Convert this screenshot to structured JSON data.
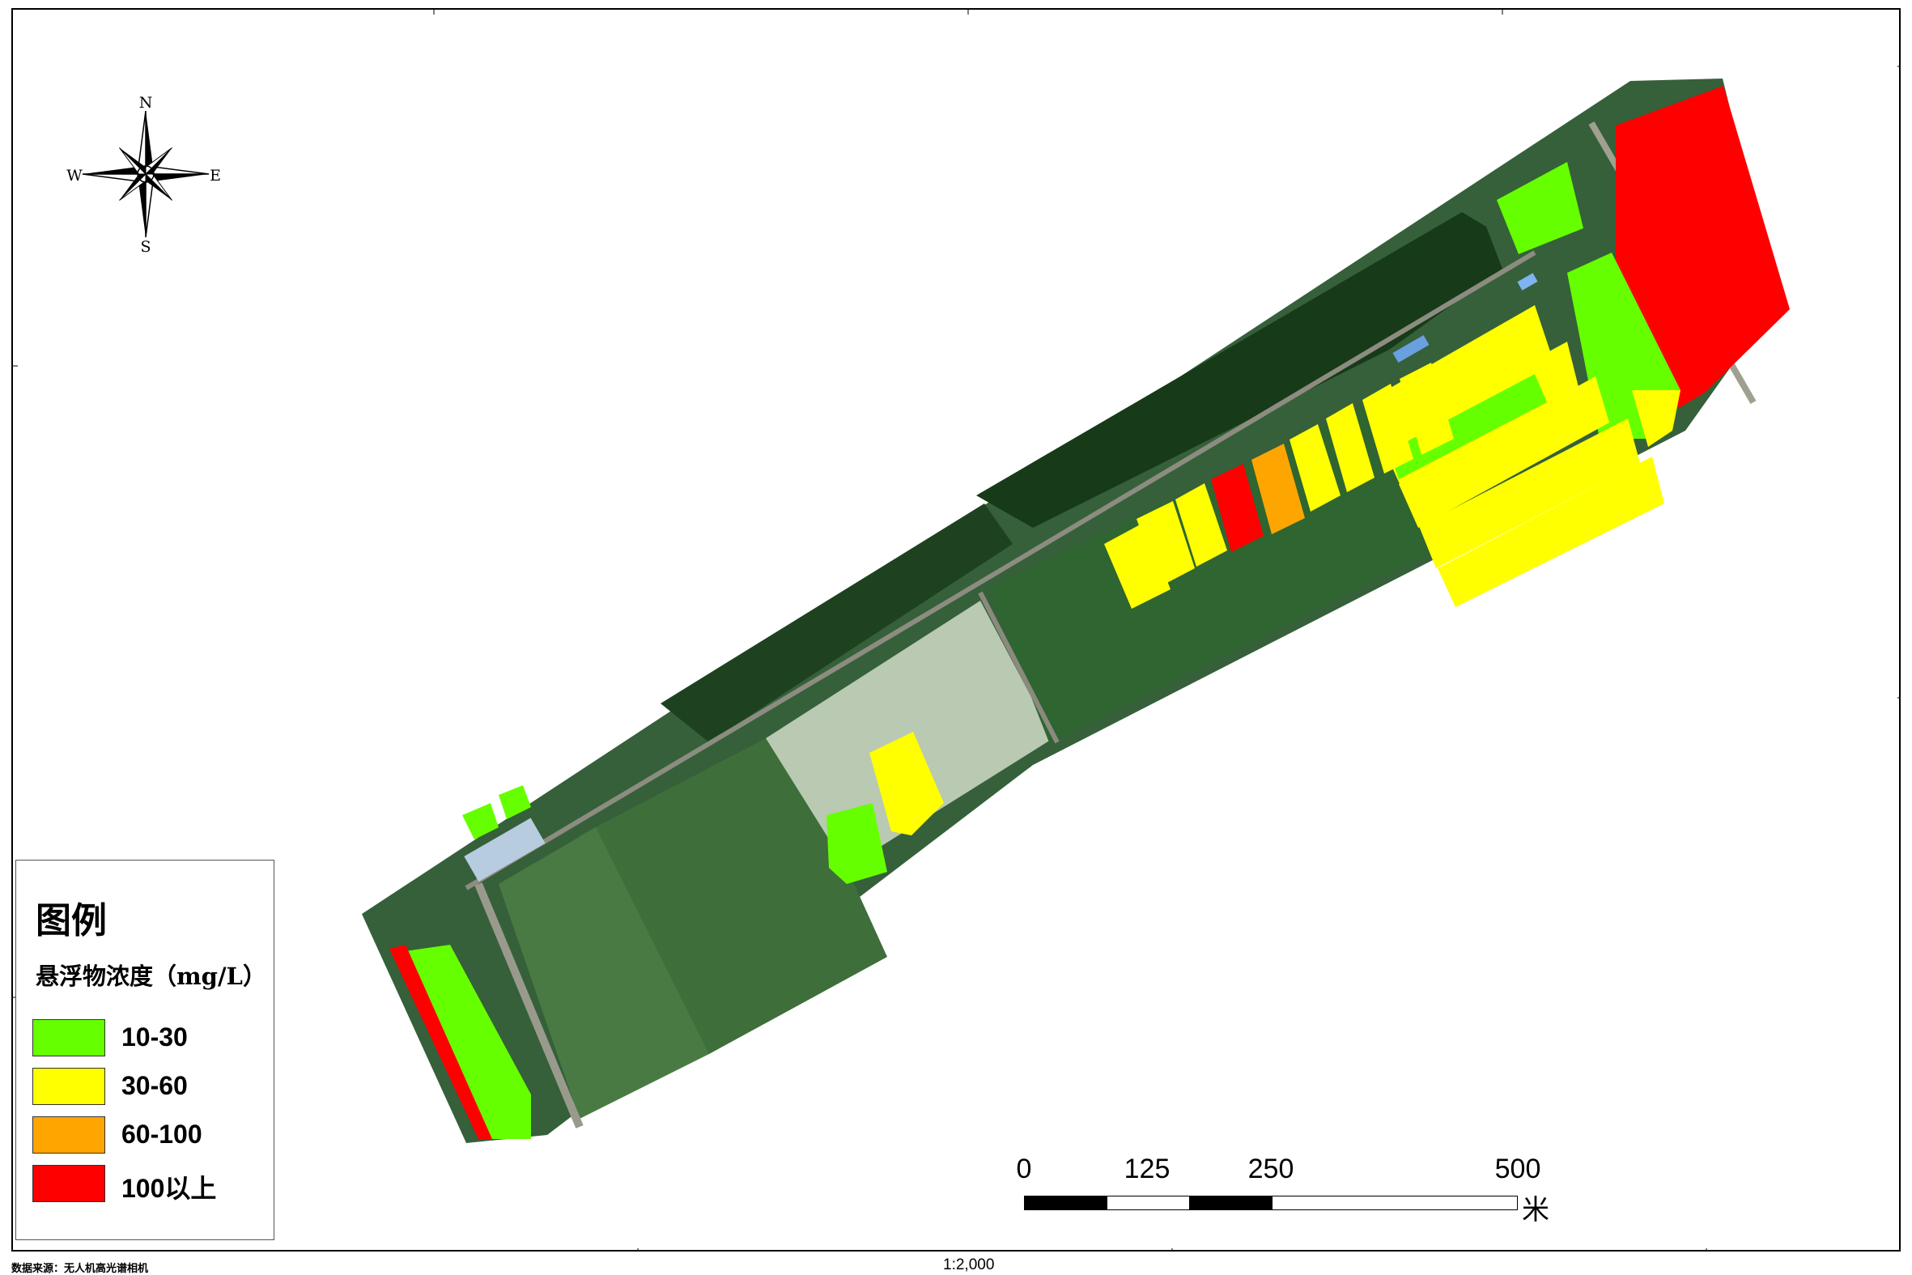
{
  "legend": {
    "title": "图例",
    "subtitle": "悬浮物浓度（mg/L）",
    "items": [
      {
        "label": "10-30",
        "color": "#66ff00"
      },
      {
        "label": "30-60",
        "color": "#ffff00"
      },
      {
        "label": "60-100",
        "color": "#ffa500"
      },
      {
        "label": "100以上",
        "color": "#ff0000"
      }
    ]
  },
  "scale_bar": {
    "labels": [
      "0",
      "125",
      "250",
      "500"
    ],
    "unit": "米"
  },
  "compass": {
    "north": "N",
    "south": "S",
    "east": "E",
    "west": "W"
  },
  "footer": {
    "data_source": "数据来源：无人机高光谱相机",
    "map_scale": "1:2,000"
  },
  "colors": {
    "class_10_30": "#66ff00",
    "class_30_60": "#ffff00",
    "class_60_100": "#ffa500",
    "class_100_plus": "#ff0000",
    "farmland": "#2e5a2a",
    "dark_water": "#1c3a1c",
    "bare_field": "#b8c8b0"
  }
}
